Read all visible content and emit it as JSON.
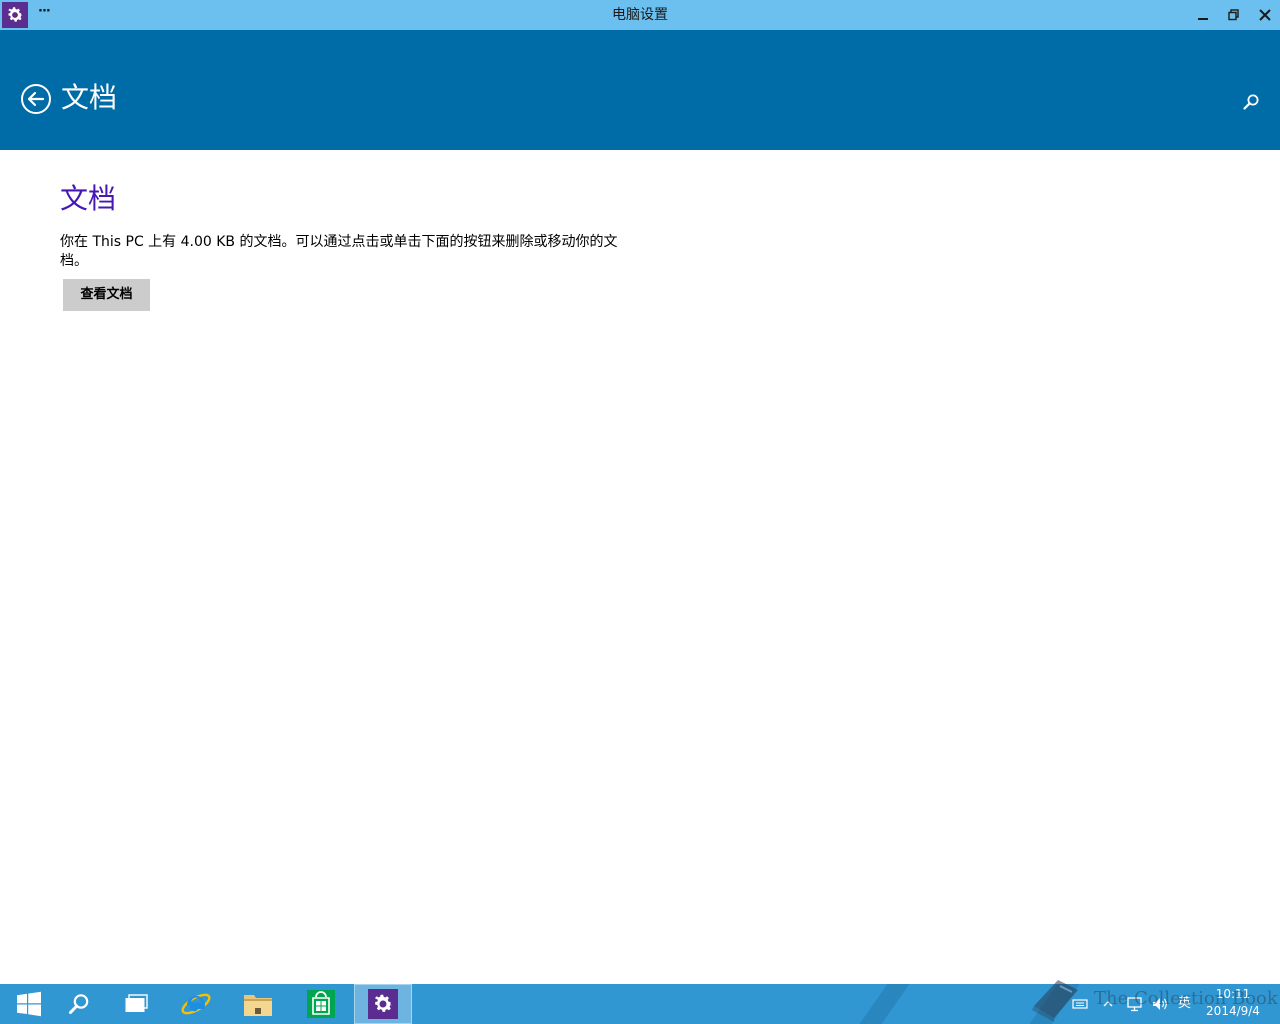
{
  "window": {
    "title": "电脑设置",
    "menu_label": "···"
  },
  "header": {
    "title": "文档"
  },
  "content": {
    "section_title": "文档",
    "description": "你在 This PC 上有 4.00 KB 的文档。可以通过点击或单击下面的按钮来删除或移动你的文档。",
    "button_label": "查看文档"
  },
  "taskbar": {
    "pinned": [
      {
        "name": "start",
        "icon": "windows-logo-icon"
      },
      {
        "name": "search",
        "icon": "search-icon"
      },
      {
        "name": "task-view",
        "icon": "task-view-icon"
      },
      {
        "name": "internet-explorer",
        "icon": "ie-icon"
      },
      {
        "name": "file-explorer",
        "icon": "folder-icon"
      },
      {
        "name": "store",
        "icon": "store-icon"
      },
      {
        "name": "pc-settings",
        "icon": "gear-icon",
        "active": true
      }
    ],
    "tray": {
      "ime_label": "英"
    },
    "clock": {
      "time": "10:11",
      "date": "2014/9/4"
    }
  },
  "watermark": {
    "text": "The Collection Book"
  },
  "colors": {
    "titlebar": "#6cc0ef",
    "header": "#006ca7",
    "section_title": "#4617b4",
    "button_bg": "#cccccc",
    "taskbar": "#3097d3",
    "app_icon_bg": "#5c2d91"
  }
}
